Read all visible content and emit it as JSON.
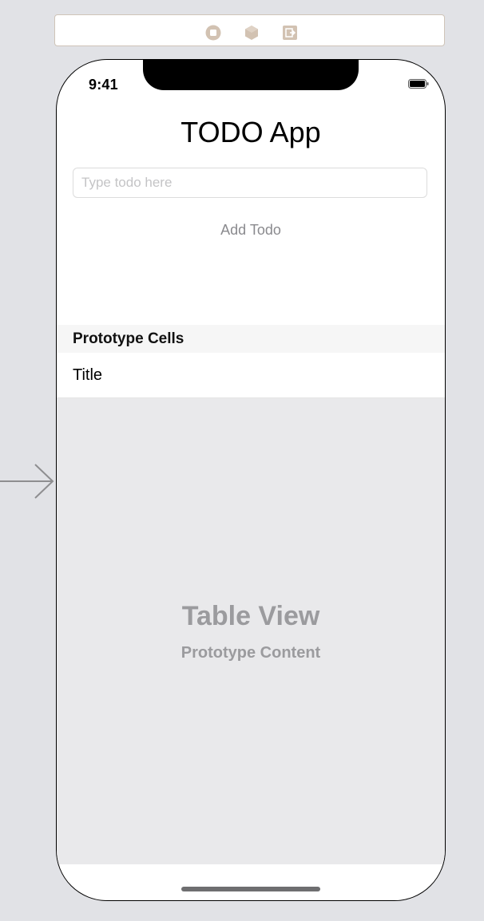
{
  "scene_dock": {
    "icons": [
      "view-controller-icon",
      "first-responder-icon",
      "exit-icon"
    ]
  },
  "status_bar": {
    "time": "9:41",
    "battery_icon": "battery-icon"
  },
  "app": {
    "title": "TODO App",
    "input_placeholder": "Type todo here",
    "add_button_label": "Add Todo"
  },
  "table": {
    "section_header": "Prototype Cells",
    "cell_title": "Title",
    "placeholder_title": "Table View",
    "placeholder_subtitle": "Prototype Content"
  },
  "colors": {
    "canvas": "#e1e2e6",
    "dock_icon": "#d2c2b2",
    "table_background": "#e9e9eb",
    "placeholder_text": "#9b9b9e",
    "button_text": "#8a8a8e"
  }
}
